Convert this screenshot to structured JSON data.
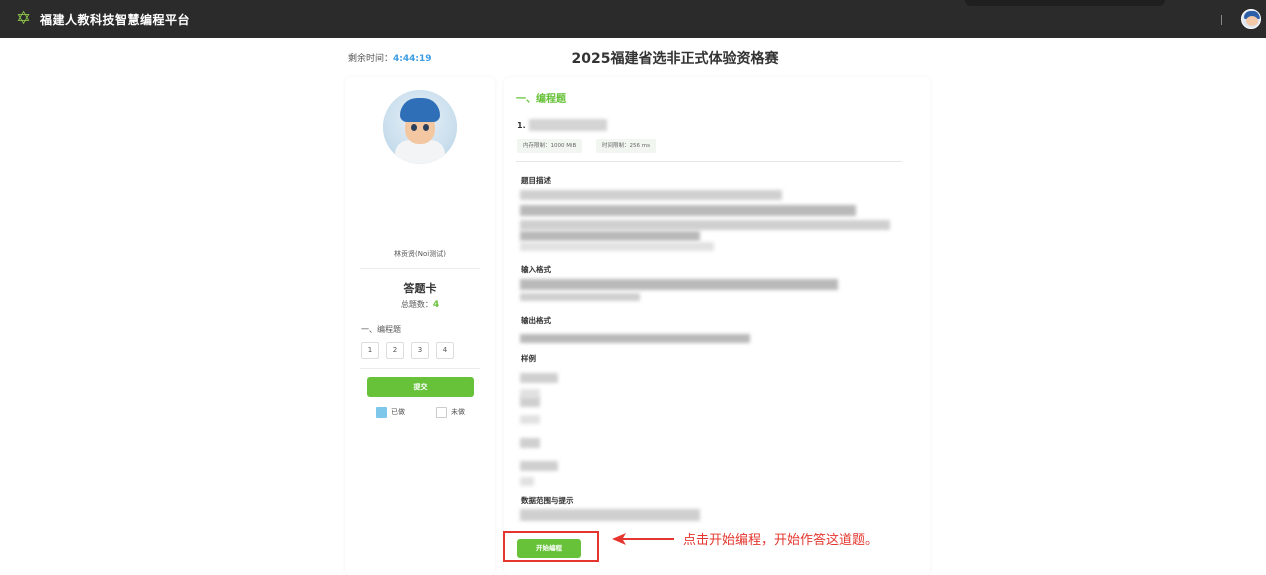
{
  "topbar": {
    "brand": "福建人教科技智慧编程平台",
    "logo_icon": "star-logo-icon",
    "avatar_icon": "user-avatar-icon"
  },
  "header": {
    "timer_label": "剩余时间：",
    "timer_value": "4:44:19",
    "title": "2025福建省选非正式体验资格赛"
  },
  "answer_card": {
    "avatar_icon": "user-avatar-icon",
    "username": "林贡贤(Noi测试)",
    "title": "答题卡",
    "total_label": "总题数：",
    "total_value": "4",
    "section_label": "一、编程题",
    "questions": [
      "1",
      "2",
      "3",
      "4"
    ],
    "submit_label": "提交",
    "legend_done": "已做",
    "legend_todo": "未做",
    "colors": {
      "done": "#7ec6ea",
      "accent": "#67c23a"
    }
  },
  "problem": {
    "section_title": "一、编程题",
    "number": "1.",
    "memory_limit": "内存限制：1000 MiB",
    "time_limit": "时间限制：256 ms",
    "desc_heading": "题目描述",
    "input_heading": "输入格式",
    "output_heading": "输出格式",
    "sample_heading": "样例",
    "range_heading": "数据范围与提示",
    "start_label": "开始编程"
  },
  "annotation": {
    "text": "点击开始编程，开始作答这道题。",
    "color": "#e4362e"
  }
}
